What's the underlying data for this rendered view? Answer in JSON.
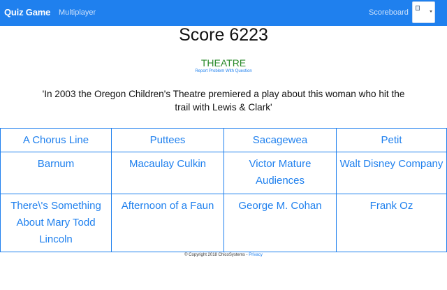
{
  "navbar": {
    "brand": "Quiz Game",
    "multiplayer_label": "Multiplayer",
    "scoreboard_label": "Scoreboard",
    "accent_color": "#1f80ee"
  },
  "score_label": "Score 6223",
  "category": "THEATRE",
  "report_link": "Report Problem With Question",
  "question": "'In 2003 the Oregon Children's Theatre premiered a play about this woman who hit the trail with Lewis & Clark'",
  "answers": [
    "A Chorus Line",
    "Puttees",
    "Sacagewea",
    "Petit",
    "Barnum",
    "Macaulay Culkin",
    "Victor Mature Audiences",
    "Walt Disney Company",
    "There\\'s Something About Mary Todd Lincoln",
    "Afternoon of a Faun",
    "George M. Cohan",
    "Frank Oz"
  ],
  "footer": {
    "copyright": "© Copyright 2018 ChicoSystems - ",
    "privacy_link": "Privacy"
  }
}
